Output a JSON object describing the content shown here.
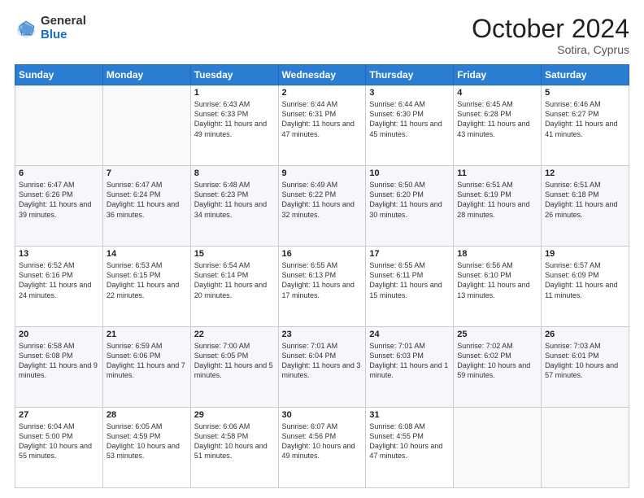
{
  "header": {
    "logo_general": "General",
    "logo_blue": "Blue",
    "month_title": "October 2024",
    "subtitle": "Sotira, Cyprus"
  },
  "days_of_week": [
    "Sunday",
    "Monday",
    "Tuesday",
    "Wednesday",
    "Thursday",
    "Friday",
    "Saturday"
  ],
  "weeks": [
    [
      {
        "day": "",
        "info": ""
      },
      {
        "day": "",
        "info": ""
      },
      {
        "day": "1",
        "info": "Sunrise: 6:43 AM\nSunset: 6:33 PM\nDaylight: 11 hours and 49 minutes."
      },
      {
        "day": "2",
        "info": "Sunrise: 6:44 AM\nSunset: 6:31 PM\nDaylight: 11 hours and 47 minutes."
      },
      {
        "day": "3",
        "info": "Sunrise: 6:44 AM\nSunset: 6:30 PM\nDaylight: 11 hours and 45 minutes."
      },
      {
        "day": "4",
        "info": "Sunrise: 6:45 AM\nSunset: 6:28 PM\nDaylight: 11 hours and 43 minutes."
      },
      {
        "day": "5",
        "info": "Sunrise: 6:46 AM\nSunset: 6:27 PM\nDaylight: 11 hours and 41 minutes."
      }
    ],
    [
      {
        "day": "6",
        "info": "Sunrise: 6:47 AM\nSunset: 6:26 PM\nDaylight: 11 hours and 39 minutes."
      },
      {
        "day": "7",
        "info": "Sunrise: 6:47 AM\nSunset: 6:24 PM\nDaylight: 11 hours and 36 minutes."
      },
      {
        "day": "8",
        "info": "Sunrise: 6:48 AM\nSunset: 6:23 PM\nDaylight: 11 hours and 34 minutes."
      },
      {
        "day": "9",
        "info": "Sunrise: 6:49 AM\nSunset: 6:22 PM\nDaylight: 11 hours and 32 minutes."
      },
      {
        "day": "10",
        "info": "Sunrise: 6:50 AM\nSunset: 6:20 PM\nDaylight: 11 hours and 30 minutes."
      },
      {
        "day": "11",
        "info": "Sunrise: 6:51 AM\nSunset: 6:19 PM\nDaylight: 11 hours and 28 minutes."
      },
      {
        "day": "12",
        "info": "Sunrise: 6:51 AM\nSunset: 6:18 PM\nDaylight: 11 hours and 26 minutes."
      }
    ],
    [
      {
        "day": "13",
        "info": "Sunrise: 6:52 AM\nSunset: 6:16 PM\nDaylight: 11 hours and 24 minutes."
      },
      {
        "day": "14",
        "info": "Sunrise: 6:53 AM\nSunset: 6:15 PM\nDaylight: 11 hours and 22 minutes."
      },
      {
        "day": "15",
        "info": "Sunrise: 6:54 AM\nSunset: 6:14 PM\nDaylight: 11 hours and 20 minutes."
      },
      {
        "day": "16",
        "info": "Sunrise: 6:55 AM\nSunset: 6:13 PM\nDaylight: 11 hours and 17 minutes."
      },
      {
        "day": "17",
        "info": "Sunrise: 6:55 AM\nSunset: 6:11 PM\nDaylight: 11 hours and 15 minutes."
      },
      {
        "day": "18",
        "info": "Sunrise: 6:56 AM\nSunset: 6:10 PM\nDaylight: 11 hours and 13 minutes."
      },
      {
        "day": "19",
        "info": "Sunrise: 6:57 AM\nSunset: 6:09 PM\nDaylight: 11 hours and 11 minutes."
      }
    ],
    [
      {
        "day": "20",
        "info": "Sunrise: 6:58 AM\nSunset: 6:08 PM\nDaylight: 11 hours and 9 minutes."
      },
      {
        "day": "21",
        "info": "Sunrise: 6:59 AM\nSunset: 6:06 PM\nDaylight: 11 hours and 7 minutes."
      },
      {
        "day": "22",
        "info": "Sunrise: 7:00 AM\nSunset: 6:05 PM\nDaylight: 11 hours and 5 minutes."
      },
      {
        "day": "23",
        "info": "Sunrise: 7:01 AM\nSunset: 6:04 PM\nDaylight: 11 hours and 3 minutes."
      },
      {
        "day": "24",
        "info": "Sunrise: 7:01 AM\nSunset: 6:03 PM\nDaylight: 11 hours and 1 minute."
      },
      {
        "day": "25",
        "info": "Sunrise: 7:02 AM\nSunset: 6:02 PM\nDaylight: 10 hours and 59 minutes."
      },
      {
        "day": "26",
        "info": "Sunrise: 7:03 AM\nSunset: 6:01 PM\nDaylight: 10 hours and 57 minutes."
      }
    ],
    [
      {
        "day": "27",
        "info": "Sunrise: 6:04 AM\nSunset: 5:00 PM\nDaylight: 10 hours and 55 minutes."
      },
      {
        "day": "28",
        "info": "Sunrise: 6:05 AM\nSunset: 4:59 PM\nDaylight: 10 hours and 53 minutes."
      },
      {
        "day": "29",
        "info": "Sunrise: 6:06 AM\nSunset: 4:58 PM\nDaylight: 10 hours and 51 minutes."
      },
      {
        "day": "30",
        "info": "Sunrise: 6:07 AM\nSunset: 4:56 PM\nDaylight: 10 hours and 49 minutes."
      },
      {
        "day": "31",
        "info": "Sunrise: 6:08 AM\nSunset: 4:55 PM\nDaylight: 10 hours and 47 minutes."
      },
      {
        "day": "",
        "info": ""
      },
      {
        "day": "",
        "info": ""
      }
    ]
  ]
}
